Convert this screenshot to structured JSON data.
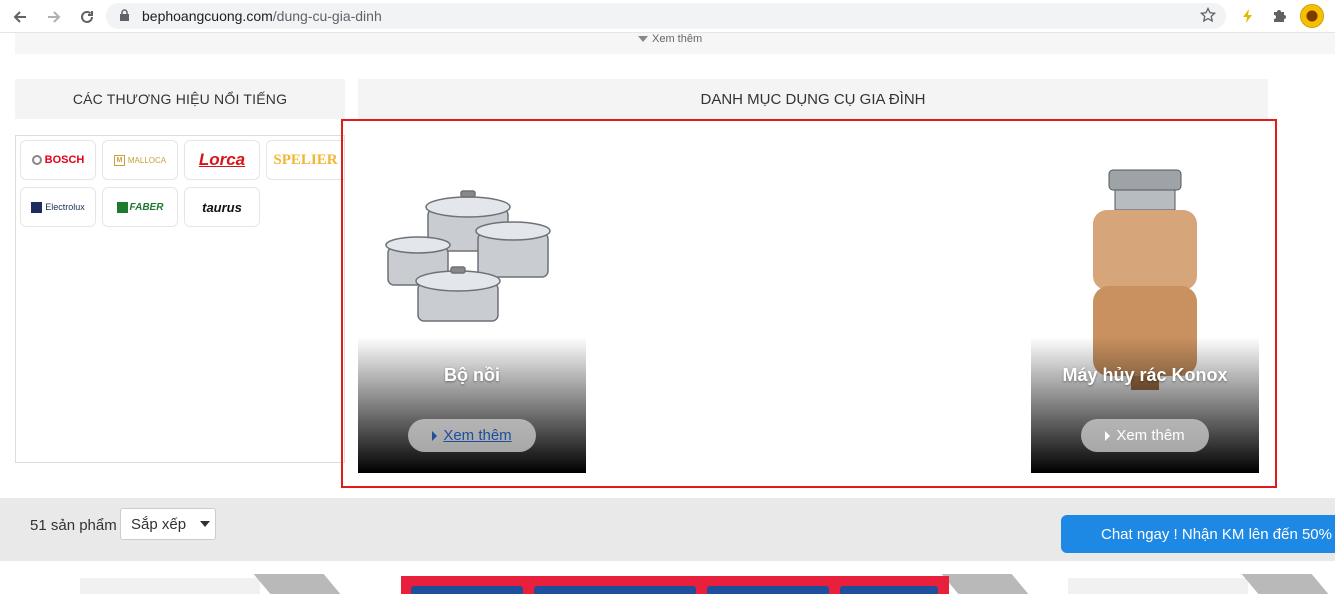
{
  "browser": {
    "url_domain": "bephoangcuong.com",
    "url_path": "/dung-cu-gia-dinh"
  },
  "top_strip": {
    "more_label": "Xem thêm"
  },
  "brands": {
    "heading": "CÁC THƯƠNG HIỆU NỔI TIẾNG",
    "items": [
      {
        "label": "BOSCH",
        "color": "#e2001a"
      },
      {
        "label": "MALLOCA",
        "color": "#c9a13c"
      },
      {
        "label": "Lorca",
        "color": "#d8141b"
      },
      {
        "label": "SPELIER",
        "color": "#f2b632"
      },
      {
        "label": "Electrolux",
        "color": "#1c2e5c"
      },
      {
        "label": "FABER",
        "color": "#1d7a2e"
      },
      {
        "label": "taurus",
        "color": "#111111"
      }
    ]
  },
  "categories": {
    "heading": "DANH MỤC DỤNG CỤ GIA ĐÌNH",
    "items": [
      {
        "title": "Bộ nồi",
        "button": "Xem thêm"
      },
      {
        "title": "Máy hủy rác Konox",
        "button": "Xem thêm"
      }
    ]
  },
  "listing": {
    "count": "51 sản phẩm",
    "sort_label": "Sắp xếp"
  },
  "chat": {
    "label": "Chat ngay ! Nhận KM lên đến 50%",
    "color": "#1e88e5"
  },
  "accent": {
    "highlight_border": "#e01b1b"
  }
}
